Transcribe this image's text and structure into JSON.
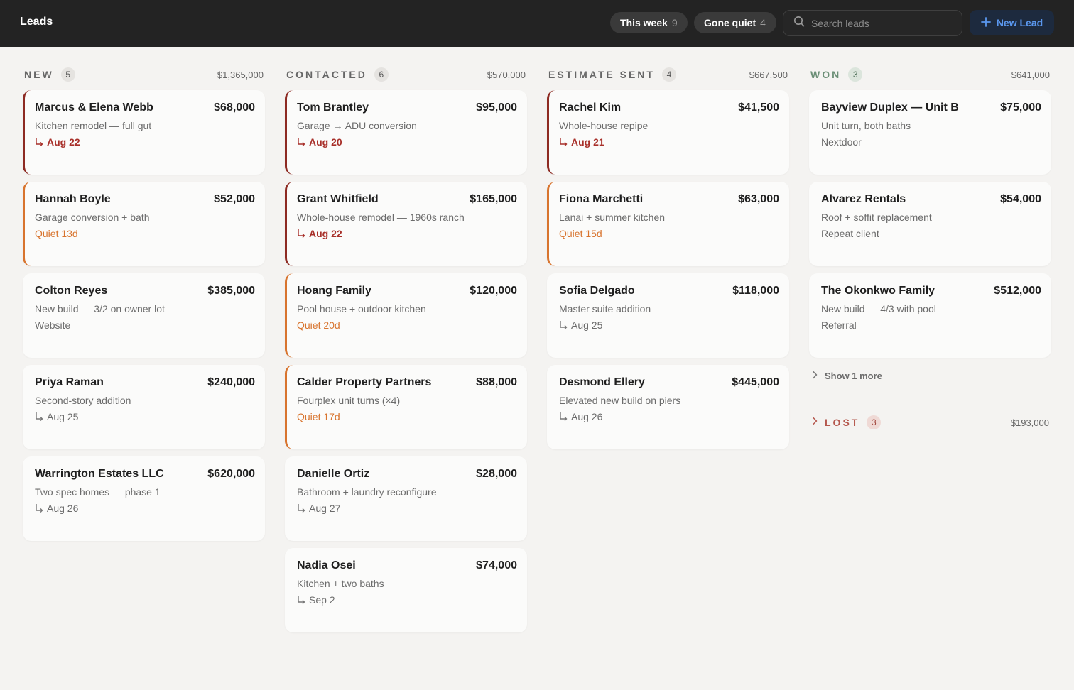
{
  "header": {
    "title": "Leads",
    "filters": [
      {
        "label": "This week",
        "count": "9"
      },
      {
        "label": "Gone quiet",
        "count": "4"
      }
    ],
    "search_placeholder": "Search leads",
    "new_lead_label": "New Lead"
  },
  "columns": [
    {
      "name": "NEW",
      "count": "5",
      "total": "$1,365,000",
      "cards": [
        {
          "name": "Marcus & Elena Webb",
          "value": "$68,000",
          "desc": "Kitchen remodel — full gut",
          "meta": "Aug 22",
          "meta_type": "due",
          "accent": "red"
        },
        {
          "name": "Hannah Boyle",
          "value": "$52,000",
          "desc": "Garage conversion + bath",
          "meta": "Quiet 13d",
          "meta_type": "quiet",
          "accent": "orange"
        },
        {
          "name": "Colton Reyes",
          "value": "$385,000",
          "desc": "New build — 3/2 on owner lot",
          "meta": "Website",
          "meta_type": "source",
          "accent": "none"
        },
        {
          "name": "Priya Raman",
          "value": "$240,000",
          "desc": "Second-story addition",
          "meta": "Aug 25",
          "meta_type": "date",
          "accent": "none"
        },
        {
          "name": "Warrington Estates LLC",
          "value": "$620,000",
          "desc": "Two spec homes — phase 1",
          "meta": "Aug 26",
          "meta_type": "date",
          "accent": "none"
        }
      ]
    },
    {
      "name": "CONTACTED",
      "count": "6",
      "total": "$570,000",
      "cards": [
        {
          "name": "Tom Brantley",
          "value": "$95,000",
          "desc": "Garage → ADU conversion",
          "meta": "Aug 20",
          "meta_type": "due",
          "accent": "red"
        },
        {
          "name": "Grant Whitfield",
          "value": "$165,000",
          "desc": "Whole-house remodel — 1960s ranch",
          "meta": "Aug 22",
          "meta_type": "due",
          "accent": "red"
        },
        {
          "name": "Hoang Family",
          "value": "$120,000",
          "desc": "Pool house + outdoor kitchen",
          "meta": "Quiet 20d",
          "meta_type": "quiet",
          "accent": "orange"
        },
        {
          "name": "Calder Property Partners",
          "value": "$88,000",
          "desc": "Fourplex unit turns (×4)",
          "meta": "Quiet 17d",
          "meta_type": "quiet",
          "accent": "orange"
        },
        {
          "name": "Danielle Ortiz",
          "value": "$28,000",
          "desc": "Bathroom + laundry reconfigure",
          "meta": "Aug 27",
          "meta_type": "date",
          "accent": "none"
        },
        {
          "name": "Nadia Osei",
          "value": "$74,000",
          "desc": "Kitchen + two baths",
          "meta": "Sep 2",
          "meta_type": "date",
          "accent": "none"
        }
      ]
    },
    {
      "name": "ESTIMATE SENT",
      "count": "4",
      "total": "$667,500",
      "cards": [
        {
          "name": "Rachel Kim",
          "value": "$41,500",
          "desc": "Whole-house repipe",
          "meta": "Aug 21",
          "meta_type": "due",
          "accent": "red"
        },
        {
          "name": "Fiona Marchetti",
          "value": "$63,000",
          "desc": "Lanai + summer kitchen",
          "meta": "Quiet 15d",
          "meta_type": "quiet",
          "accent": "orange"
        },
        {
          "name": "Sofia Delgado",
          "value": "$118,000",
          "desc": "Master suite addition",
          "meta": "Aug 25",
          "meta_type": "date",
          "accent": "none"
        },
        {
          "name": "Desmond Ellery",
          "value": "$445,000",
          "desc": "Elevated new build on piers",
          "meta": "Aug 26",
          "meta_type": "date",
          "accent": "none"
        }
      ]
    },
    {
      "name": "WON",
      "count": "3",
      "total": "$641,000",
      "cards": [
        {
          "name": "Bayview Duplex — Unit B",
          "value": "$75,000",
          "desc": "Unit turn, both baths",
          "meta": "Nextdoor",
          "meta_type": "source",
          "accent": "none"
        },
        {
          "name": "Alvarez Rentals",
          "value": "$54,000",
          "desc": "Roof + soffit replacement",
          "meta": "Repeat client",
          "meta_type": "source",
          "accent": "none"
        },
        {
          "name": "The Okonkwo Family",
          "value": "$512,000",
          "desc": "New build — 4/3 with pool",
          "meta": "Referral",
          "meta_type": "source",
          "accent": "none"
        }
      ],
      "show_more_label": "Show 1 more"
    }
  ],
  "lost": {
    "name": "LOST",
    "count": "3",
    "total": "$193,000"
  },
  "colors": {
    "topbar": "#232323",
    "due": "#a8302a",
    "quiet": "#d8742e",
    "won": "#6b8f76",
    "lost": "#b5584e",
    "accent_blue": "#5a97ee"
  }
}
